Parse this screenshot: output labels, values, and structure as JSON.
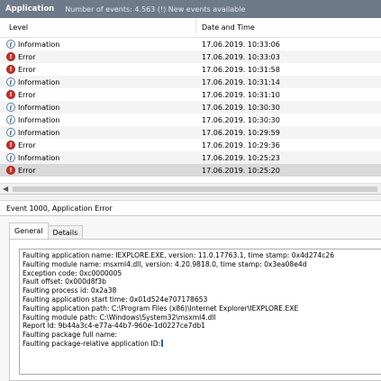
{
  "header": {
    "title": "Application",
    "info": "Number of events: 4.563 (!) New events available"
  },
  "columns": {
    "level": "Level",
    "date": "Date and Time"
  },
  "events": [
    {
      "level": "Information",
      "type": "info",
      "date": "17.06.2019. 10:33:06"
    },
    {
      "level": "Error",
      "type": "error",
      "date": "17.06.2019. 10:33:03"
    },
    {
      "level": "Error",
      "type": "error",
      "date": "17.06.2019. 10:31:58"
    },
    {
      "level": "Information",
      "type": "info",
      "date": "17.06.2019. 10:31:14"
    },
    {
      "level": "Error",
      "type": "error",
      "date": "17.06.2019. 10:31:10"
    },
    {
      "level": "Information",
      "type": "info",
      "date": "17.06.2019. 10:30:30"
    },
    {
      "level": "Information",
      "type": "info",
      "date": "17.06.2019. 10:30:30"
    },
    {
      "level": "Information",
      "type": "info",
      "date": "17.06.2019. 10:29:59"
    },
    {
      "level": "Error",
      "type": "error",
      "date": "17.06.2019. 10:29:36"
    },
    {
      "level": "Information",
      "type": "info",
      "date": "17.06.2019. 10:25:23"
    },
    {
      "level": "Error",
      "type": "error",
      "date": "17.06.2019. 10:25:20"
    }
  ],
  "selected_index": 10,
  "detail": {
    "title": "Event 1000, Application Error",
    "tabs": [
      "General",
      "Details"
    ],
    "active_tab": "General",
    "message_lines": [
      "Faulting application name: IEXPLORE.EXE, version: 11.0.17763.1, time stamp: 0x4d274c26",
      "Faulting module name: msxml4.dll, version: 4.20.9818.0, time stamp: 0x3ea08e4d",
      "Exception code: 0xc0000005",
      "Fault offset: 0x000d8f3b",
      "Faulting process id: 0x2a38",
      "Faulting application start time: 0x01d524e707178653",
      "Faulting application path: C:\\Program Files (x86)\\Internet Explorer\\IEXPLORE.EXE",
      "Faulting module path: C:\\Windows\\System32\\msxml4.dll",
      "Report Id: 9b44a3c4-e77a-44b7-960e-1d0227ce7db1",
      "Faulting package full name:",
      "Faulting package-relative application ID:"
    ]
  },
  "icons": {
    "info": "information-icon",
    "error": "error-icon"
  },
  "colors": {
    "titlebar": "#6c7a89",
    "error": "#c8312b",
    "info_ring": "#5a7ca8",
    "selection": "#d9d9d9"
  }
}
